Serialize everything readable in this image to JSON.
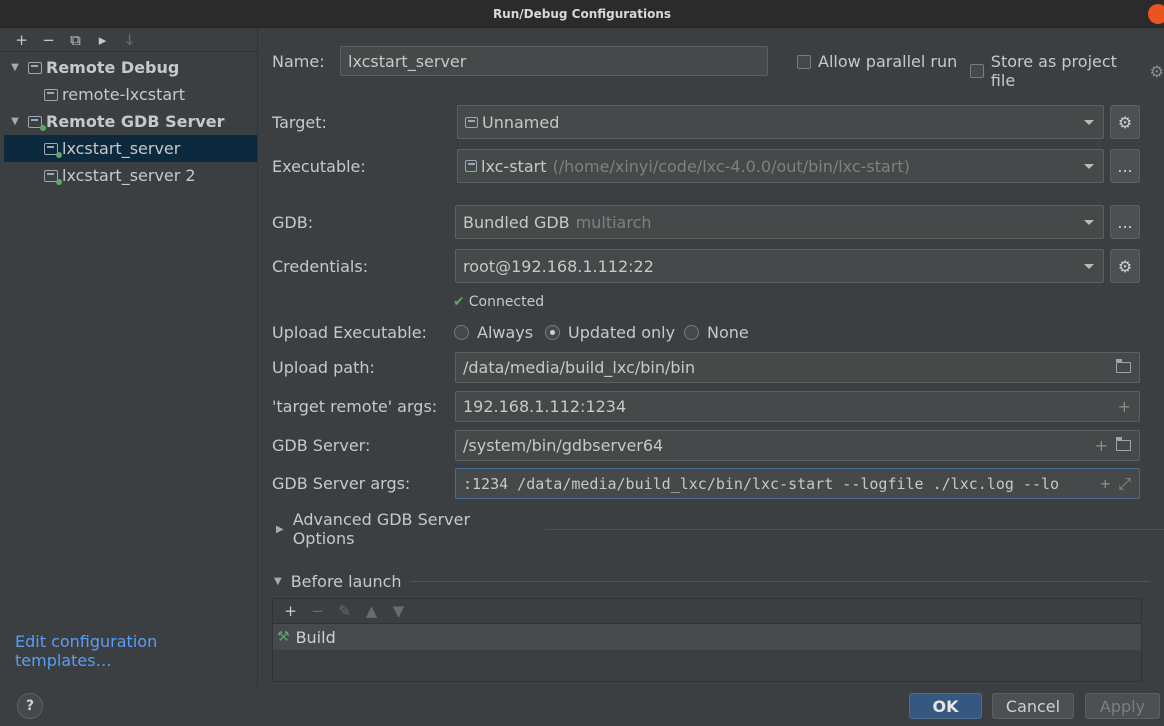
{
  "window": {
    "title": "Run/Debug Configurations"
  },
  "tree": {
    "toolbar": [
      "+",
      "−",
      "⧉",
      "▸",
      "↓"
    ],
    "items": [
      {
        "label": "Remote Debug",
        "group": true
      },
      {
        "label": "remote-lxcstart",
        "group": false
      },
      {
        "label": "Remote GDB Server",
        "group": true
      },
      {
        "label": "lxcstart_server",
        "group": false,
        "selected": true
      },
      {
        "label": "lxcstart_server 2",
        "group": false
      }
    ],
    "edit_templates": "Edit configuration templates…"
  },
  "form": {
    "name_label": "Name:",
    "name_value": "lxcstart_server",
    "allow_parallel": "Allow parallel run",
    "store_project": "Store as project file",
    "target_label": "Target:",
    "target_value": "Unnamed",
    "executable_label": "Executable:",
    "executable_value": "lxc-start",
    "executable_hint": "(/home/xinyi/code/lxc-4.0.0/out/bin/lxc-start)",
    "gdb_label": "GDB:",
    "gdb_value": "Bundled GDB",
    "gdb_hint": "multiarch",
    "credentials_label": "Credentials:",
    "credentials_value": "root@192.168.1.112:22",
    "connected": "Connected",
    "upload_exec_label": "Upload Executable:",
    "upload_options": [
      "Always",
      "Updated only",
      "None"
    ],
    "upload_selected": "Updated only",
    "upload_path_label": "Upload path:",
    "upload_path_value": "/data/media/build_lxc/bin/bin",
    "target_remote_label": "'target remote' args:",
    "target_remote_value": "192.168.1.112:1234",
    "gdb_server_label": "GDB Server:",
    "gdb_server_value": "/system/bin/gdbserver64",
    "gdb_server_args_label": "GDB Server args:",
    "gdb_server_args_value": ":1234 /data/media/build_lxc/bin/lxc-start --logfile ./lxc.log --lo",
    "advanced": "Advanced GDB Server Options",
    "before_launch": "Before launch",
    "before_launch_item": "Build",
    "ellipsis": "..."
  },
  "buttons": {
    "ok": "OK",
    "cancel": "Cancel",
    "apply": "Apply",
    "help": "?"
  },
  "colors": {
    "accent": "#589df6",
    "ok_bg": "#365880",
    "selection": "#0d293e",
    "connected": "#59a869"
  }
}
